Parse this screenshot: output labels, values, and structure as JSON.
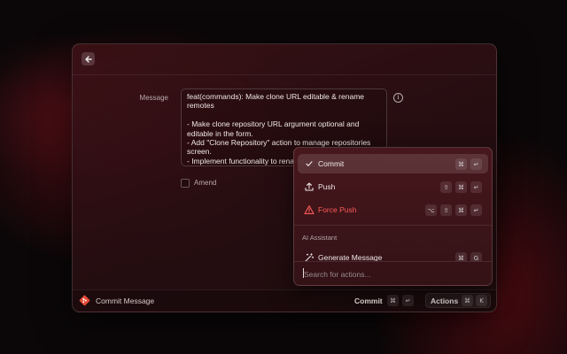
{
  "form": {
    "message_label": "Message",
    "message_value": "feat(commands): Make clone URL editable & rename remotes\n\n- Make clone repository URL argument optional and editable in the form.\n- Add \"Clone Repository\" action to manage repositories screen.\n- Implement functionality to rename remotes.",
    "amend_label": "Amend",
    "amend_checked": false
  },
  "bottombar": {
    "title": "Commit Message",
    "primary_action": "Commit",
    "primary_shortcut": [
      "⌘",
      "↵"
    ],
    "actions_label": "Actions",
    "actions_shortcut": [
      "⌘",
      "K"
    ]
  },
  "panel": {
    "items": [
      {
        "label": "Commit",
        "icon": "checkmark-icon",
        "shortcut": [
          "⌘",
          "↵"
        ],
        "selected": true
      },
      {
        "label": "Push",
        "icon": "upload-icon",
        "shortcut": [
          "⇧",
          "⌘",
          "↵"
        ]
      },
      {
        "label": "Force Push",
        "icon": "warning-icon",
        "shortcut": [
          "⌥",
          "⇧",
          "⌘",
          "↵"
        ],
        "danger": true
      }
    ],
    "section_title": "AI Assistant",
    "ai_items": [
      {
        "label": "Generate Message",
        "icon": "sparkle-icon",
        "shortcut": [
          "⌘",
          "G"
        ]
      }
    ],
    "search_placeholder": "Search for actions..."
  },
  "colors": {
    "danger": "#ff5a5a",
    "git_brand": "#e24a35"
  }
}
